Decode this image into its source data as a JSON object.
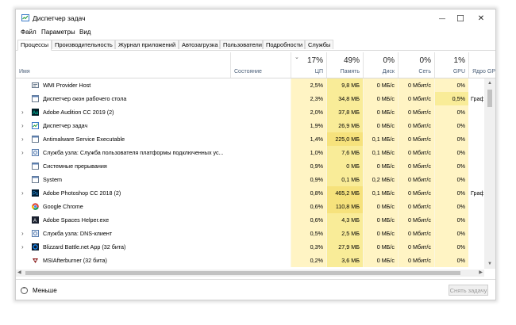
{
  "window": {
    "title": "Диспетчер задач",
    "controls": {
      "minimize": "—",
      "maximize": "☐",
      "close": "✕"
    }
  },
  "menu": [
    "Файл",
    "Параметры",
    "Вид"
  ],
  "tabs": [
    "Процессы",
    "Производительность",
    "Журнал приложений",
    "Автозагрузка",
    "Пользователи",
    "Подробности",
    "Службы"
  ],
  "columns": {
    "name": "Имя",
    "status": "Состояние",
    "cpu": {
      "pct": "17%",
      "label": "ЦП"
    },
    "memory": {
      "pct": "49%",
      "label": "Память"
    },
    "disk": {
      "pct": "0%",
      "label": "Диск"
    },
    "network": {
      "pct": "0%",
      "label": "Сеть"
    },
    "gpu": {
      "pct": "1%",
      "label": "GPU"
    },
    "gpu_engine": {
      "label": "Ядро GP"
    }
  },
  "processes": [
    {
      "name": "WMI Provider Host",
      "expand": false,
      "icon": "service-icon",
      "cpu": "2,5%",
      "mem": "9,8 МБ",
      "disk": "0 МБ/с",
      "net": "0 Мбит/с",
      "gpu": "0%",
      "engine": ""
    },
    {
      "name": "Диспетчер окон рабочего стола",
      "expand": false,
      "icon": "window-icon",
      "cpu": "2,3%",
      "mem": "34,8 МБ",
      "disk": "0 МБ/с",
      "net": "0 Мбит/с",
      "gpu": "0,5%",
      "engine": "Граф"
    },
    {
      "name": "Adobe Audition CC 2019 (2)",
      "expand": true,
      "icon": "audition-icon",
      "cpu": "2,0%",
      "mem": "37,8 МБ",
      "disk": "0 МБ/с",
      "net": "0 Мбит/с",
      "gpu": "0%",
      "engine": ""
    },
    {
      "name": "Диспетчер задач",
      "expand": true,
      "icon": "taskmgr-icon",
      "cpu": "1,9%",
      "mem": "26,9 МБ",
      "disk": "0 МБ/с",
      "net": "0 Мбит/с",
      "gpu": "0%",
      "engine": ""
    },
    {
      "name": "Antimalware Service Executable",
      "expand": true,
      "icon": "window-icon",
      "cpu": "1,4%",
      "mem": "225,0 МБ",
      "disk": "0,1 МБ/с",
      "net": "0 Мбит/с",
      "gpu": "0%",
      "engine": ""
    },
    {
      "name": "Служба узла: Служба пользователя платформы подключенных ус...",
      "expand": true,
      "icon": "gear-icon",
      "cpu": "1,0%",
      "mem": "7,6 МБ",
      "disk": "0,1 МБ/с",
      "net": "0 Мбит/с",
      "gpu": "0%",
      "engine": ""
    },
    {
      "name": "Системные прерывания",
      "expand": false,
      "icon": "window-icon",
      "cpu": "0,9%",
      "mem": "0 МБ",
      "disk": "0 МБ/с",
      "net": "0 Мбит/с",
      "gpu": "0%",
      "engine": ""
    },
    {
      "name": "System",
      "expand": false,
      "icon": "window-icon",
      "cpu": "0,9%",
      "mem": "0,1 МБ",
      "disk": "0,2 МБ/с",
      "net": "0 Мбит/с",
      "gpu": "0%",
      "engine": ""
    },
    {
      "name": "Adobe Photoshop CC 2018 (2)",
      "expand": true,
      "icon": "photoshop-icon",
      "cpu": "0,8%",
      "mem": "465,2 МБ",
      "disk": "0,1 МБ/с",
      "net": "0 Мбит/с",
      "gpu": "0%",
      "engine": "Граф"
    },
    {
      "name": "Google Chrome",
      "expand": false,
      "icon": "chrome-icon",
      "cpu": "0,6%",
      "mem": "110,8 МБ",
      "disk": "0 МБ/с",
      "net": "0 Мбит/с",
      "gpu": "0%",
      "engine": ""
    },
    {
      "name": "Adobe Spaces Helper.exe",
      "expand": false,
      "icon": "adobe-icon",
      "cpu": "0,6%",
      "mem": "4,3 МБ",
      "disk": "0 МБ/с",
      "net": "0 Мбит/с",
      "gpu": "0%",
      "engine": ""
    },
    {
      "name": "Служба узла: DNS-клиент",
      "expand": true,
      "icon": "gear-icon",
      "cpu": "0,5%",
      "mem": "2,5 МБ",
      "disk": "0 МБ/с",
      "net": "0 Мбит/с",
      "gpu": "0%",
      "engine": ""
    },
    {
      "name": "Blizzard Battle.net App (32 бита)",
      "expand": true,
      "icon": "battlenet-icon",
      "cpu": "0,3%",
      "mem": "27,9 МБ",
      "disk": "0 МБ/с",
      "net": "0 Мбит/с",
      "gpu": "0%",
      "engine": ""
    },
    {
      "name": "MSIAfterburner (32 бита)",
      "expand": false,
      "icon": "afterburner-icon",
      "cpu": "0,2%",
      "mem": "3,6 МБ",
      "disk": "0 МБ/с",
      "net": "0 Мбит/с",
      "gpu": "0%",
      "engine": ""
    }
  ],
  "footer": {
    "less_label": "Меньше",
    "end_task_label": "Снять задачу"
  },
  "colors": {
    "heat_light": "#fff4c4",
    "heat_mid": "#f9ec98",
    "heat_strong": "#f6e27c",
    "accent": "#0078d7",
    "header_text": "#4c607a"
  }
}
